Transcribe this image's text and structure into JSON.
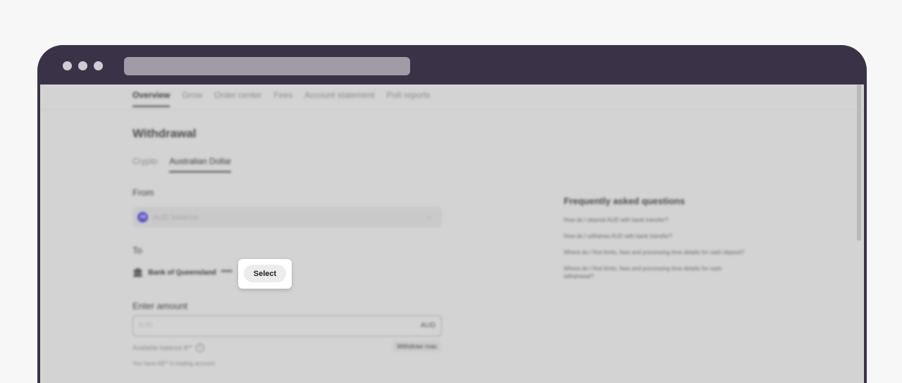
{
  "nav": {
    "tabs": [
      "Overview",
      "Grow",
      "Order center",
      "Fees",
      "Account statement",
      "PoII reports"
    ],
    "active_index": 0
  },
  "page": {
    "title": "Withdrawal"
  },
  "subtabs": [
    "Crypto",
    "Australian Dollar"
  ],
  "from": {
    "label": "From",
    "icon_text": "A$",
    "value": "AUD balance"
  },
  "to": {
    "label": "To",
    "bank_name": "Bank of Queensland",
    "bank_mask": "****",
    "select_label": "Select"
  },
  "amount": {
    "label": "Enter amount",
    "placeholder": "0.00",
    "currency": "AUD",
    "available": "Available balance $**",
    "withdraw_max": "Withdraw max",
    "trading_note": "You have A$** in trading account"
  },
  "faq": {
    "title": "Frequently asked questions",
    "items": [
      "How do I deposit AUD with bank transfer?",
      "How do I withdraw AUD with bank transfer?",
      "Where do I find limits, fees and processing time details for cash deposit?",
      "Where do I find limits, fees and processing time details for cash withdrawal?"
    ]
  },
  "icons": {
    "bank": "bank-icon",
    "info": "info-icon",
    "chevron": "chevron-down-icon",
    "aud": "aud-currency-icon"
  },
  "colors": {
    "browser_chrome": "#3a3347",
    "accent": "#5b4fc4"
  }
}
